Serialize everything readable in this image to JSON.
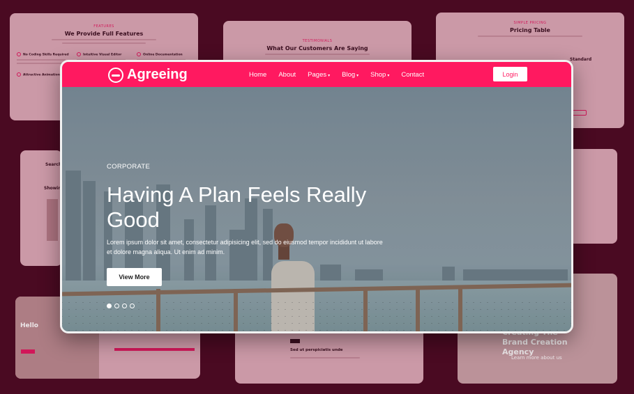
{
  "background_cards": {
    "features": {
      "kicker": "FEATURES",
      "title": "We Provide Full Features",
      "items": [
        "No Coding Skills Required",
        "Intuitive Visual Editor",
        "Online Documentation"
      ],
      "extra": "Attractive Animations"
    },
    "testimonials": {
      "kicker": "TESTIMONIALS",
      "title": "What Our Customers Are Saying"
    },
    "pricing": {
      "kicker": "SIMPLE PRICING",
      "title": "Pricing Table",
      "plan": "Standard"
    },
    "search": {
      "title": "Search"
    },
    "showing": {
      "title": "Showin"
    },
    "hello": {
      "title": "Hello"
    },
    "post": {
      "title": "Sed ut perspiciatis unde"
    },
    "agency": {
      "title": "Creating The Brand Creation Agency",
      "sub": "Learn more about us"
    }
  },
  "navbar": {
    "logo": "Agreeing",
    "links": [
      {
        "label": "Home",
        "has_caret": false
      },
      {
        "label": "About",
        "has_caret": false
      },
      {
        "label": "Pages",
        "has_caret": true
      },
      {
        "label": "Blog",
        "has_caret": true
      },
      {
        "label": "Shop",
        "has_caret": true
      },
      {
        "label": "Contact",
        "has_caret": false
      }
    ],
    "login": "Login"
  },
  "hero": {
    "kicker": "CORPORATE",
    "title": "Having A Plan Feels Really Good",
    "description": "Lorem ipsum dolor sit amet, consectetur adipisicing elit, sed do eiusmod tempor incididunt ut labore et dolore magna aliqua. Ut enim ad minim.",
    "button": "View More",
    "slides": 4,
    "active_slide": 1
  },
  "colors": {
    "brand": "#ff1960",
    "page_background": "#4a0a22"
  }
}
